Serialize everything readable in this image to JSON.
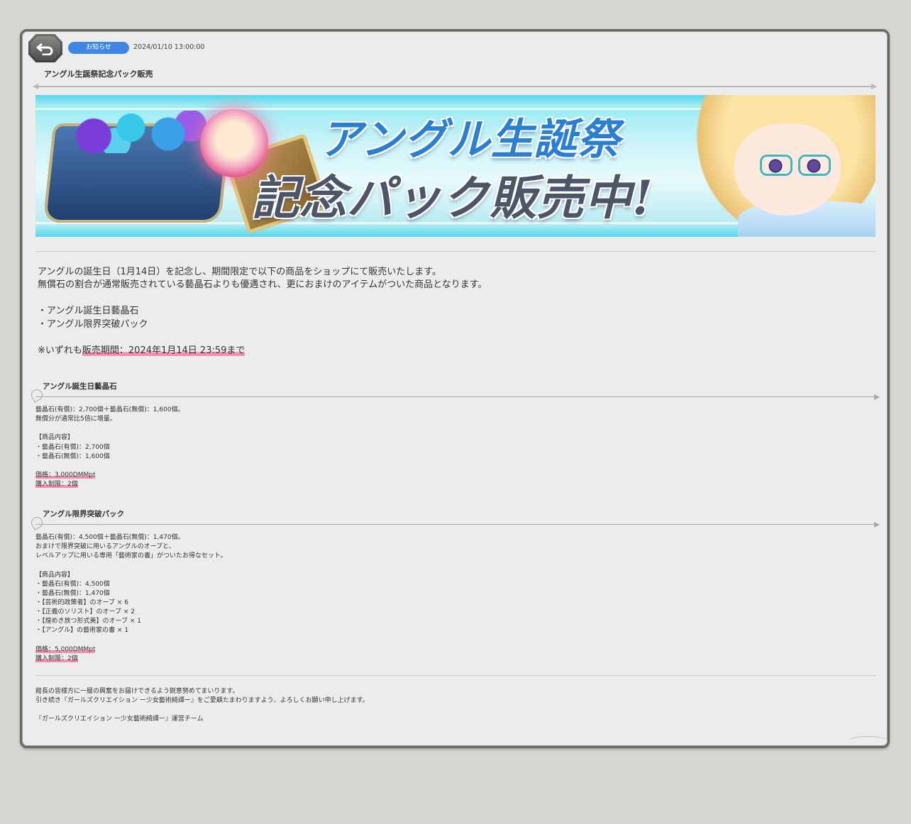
{
  "header": {
    "badge_label": "お知らせ",
    "date": "2024/01/10 13:00:00",
    "title": "アングル生誕祭記念パック販売"
  },
  "banner": {
    "headline_line1": "アングル生誕祭",
    "headline_line2": "記念パック販売中!"
  },
  "intro": {
    "line1": "アングルの誕生日（1月14日）を記念し、期間限定で以下の商品をショップにて販売いたします。",
    "line2": "無償石の割合が通常販売されている藝晶石よりも優遇され、更におまけのアイテムがついた商品となります。",
    "items": [
      "・アングル誕生日藝晶石",
      "・アングル限界突破パック"
    ],
    "period_prefix": "※いずれも",
    "period_highlight": "販売期間：2024年1月14日 23:59まで"
  },
  "section1": {
    "title": "アングル誕生日藝晶石",
    "lines": [
      "藝晶石(有償)：2,700個＋藝晶石(無償)：1,600個。",
      "無償分が通常比5倍に増量。"
    ],
    "contents_header": "【商品内容】",
    "contents": [
      "・藝晶石(有償)：2,700個",
      "・藝晶石(無償)：1,600個"
    ],
    "price": "価格：3,000DMMpt",
    "limit": "購入制限：2個"
  },
  "section2": {
    "title": "アングル限界突破パック",
    "lines": [
      "藝晶石(有償)：4,500個＋藝晶石(無償)：1,470個。",
      "おまけで限界突破に用いるアングルのオーブと、",
      "レベルアップに用いる専用「藝術家の書」がついたお得なセット。"
    ],
    "contents_header": "【商品内容】",
    "contents": [
      "・藝晶石(有償)：4,500個",
      "・藝晶石(無償)：1,470個",
      "・【芸術的政策者】のオーブ × 6",
      "・【正義のソリスト】のオーブ × 2",
      "・【煌めき放つ形式美】のオーブ × 1",
      "・【アングル】の藝術家の書 × 1"
    ],
    "price": "価格：5,000DMMpt",
    "limit": "購入制限：2個"
  },
  "footer": {
    "line1": "館長の皆様方に一層の興奮をお届けできるよう鋭意努めてまいります。",
    "line2": "引き続き『ガールズクリエイション ー少女藝術綺譚ー』をご愛顧たまわりますよう、よろしくお願い申し上げます。",
    "signature": "『ガールズクリエイション ー少女藝術綺譚ー』運営チーム"
  },
  "colors": {
    "background": "#d6d5d0",
    "panel": "#ececec",
    "badge": "#3f86e6",
    "highlight": "#f48db1"
  },
  "icons": {
    "back": "back-arrow-icon"
  }
}
